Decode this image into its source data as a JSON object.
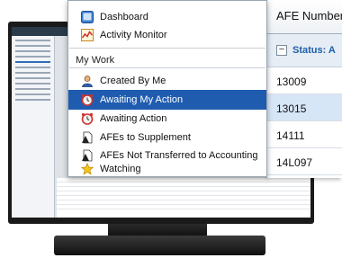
{
  "nav": {
    "top_items": [
      {
        "label": "Dashboard",
        "icon": "dashboard-icon"
      },
      {
        "label": "Activity Monitor",
        "icon": "activity-monitor-icon"
      }
    ],
    "section_title": "My Work",
    "work_items": [
      {
        "label": "Created By Me",
        "icon": "user-icon",
        "selected": false
      },
      {
        "label": "Awaiting My Action",
        "icon": "alarm-clock-icon",
        "selected": true
      },
      {
        "label": "Awaiting Action",
        "icon": "alarm-clock-icon",
        "selected": false
      },
      {
        "label": "AFEs to Supplement",
        "icon": "afe-document-icon",
        "selected": false
      },
      {
        "label": "AFEs Not Transferred to Accounting",
        "icon": "afe-document-icon",
        "selected": false
      },
      {
        "label": "Watching",
        "icon": "star-icon",
        "selected": false
      }
    ]
  },
  "grid": {
    "column_header": "AFE Number",
    "group_label": "Status: A",
    "rows": [
      "13009",
      "13015",
      "14111",
      "14L097"
    ],
    "selected_row": "13015"
  },
  "colors": {
    "selection": "#1f5cb0",
    "group_label": "#1f5fa8"
  }
}
